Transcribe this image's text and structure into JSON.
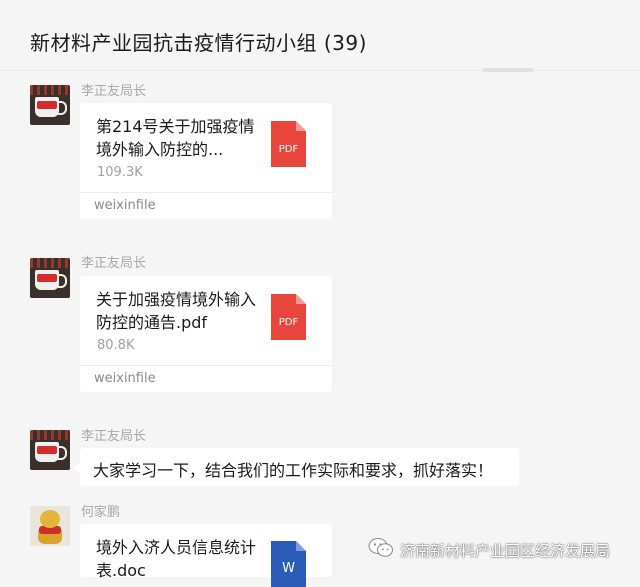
{
  "header": {
    "title": "新材料产业园抗击疫情行动小组 (39)"
  },
  "messages": [
    {
      "sender": "李正友局长",
      "type": "file",
      "file_name": "第214号关于加强疫情境外输入防控的...",
      "file_size": "109.3K",
      "file_type": "PDF",
      "source": "weixinfile"
    },
    {
      "sender": "李正友局长",
      "type": "file",
      "file_name": "关于加强疫情境外输入防控的通告.pdf",
      "file_size": "80.8K",
      "file_type": "PDF",
      "source": "weixinfile"
    },
    {
      "sender": "李正友局长",
      "type": "text",
      "text": "大家学习一下，结合我们的工作实际和要求，抓好落实！"
    },
    {
      "sender": "何家鹏",
      "type": "file",
      "file_name": "境外入济人员信息统计表.doc",
      "file_type": "W"
    }
  ],
  "watermark": {
    "text": "济南新材料产业园区经济发展局"
  },
  "colors": {
    "pdf_red": "#e8453c",
    "word_blue": "#2b5bb7",
    "bubble": "#ffffff",
    "background": "#f5f5f5"
  }
}
